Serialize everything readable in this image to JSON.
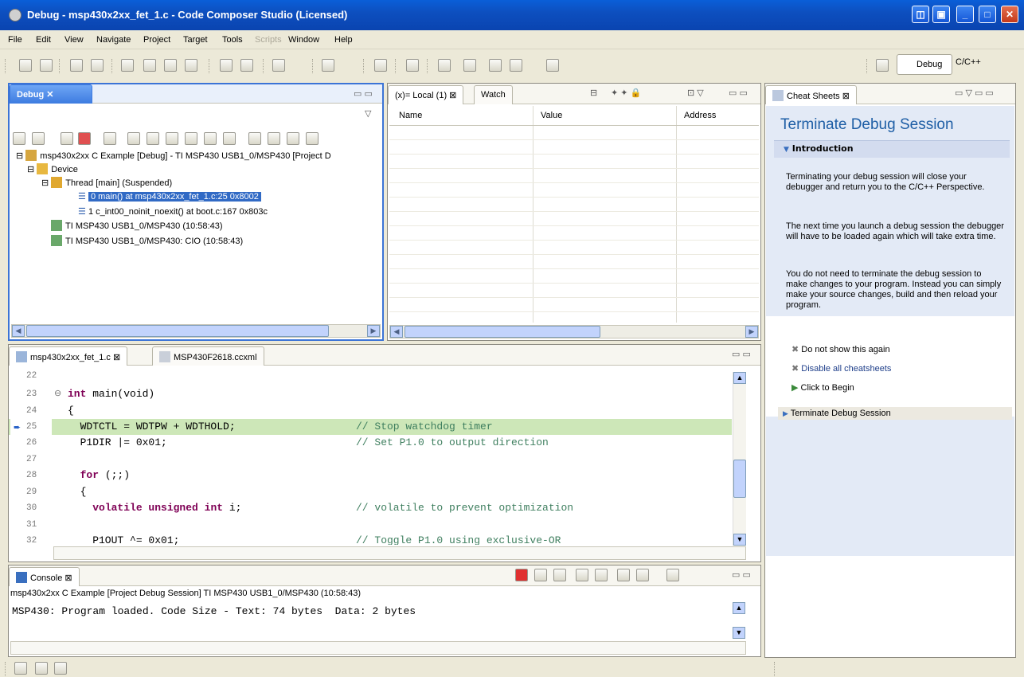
{
  "window": {
    "title": "Debug - msp430x2xx_fet_1.c - Code Composer Studio (Licensed)"
  },
  "menu": [
    "File",
    "Edit",
    "View",
    "Navigate",
    "Project",
    "Target",
    "Tools",
    "Scripts",
    "Window",
    "Help"
  ],
  "perspectives": {
    "debug": "Debug",
    "cpp": "C/C++"
  },
  "debug_view": {
    "tab": "Debug",
    "tree": [
      "msp430x2xx C Example [Debug] - TI MSP430 USB1_0/MSP430 [Project D",
      "Device",
      "Thread [main] (Suspended)",
      "0 main() at msp430x2xx_fet_1.c:25 0x8002",
      "1 c_int00_noinit_noexit() at boot.c:167 0x803c",
      "TI MSP430 USB1_0/MSP430 (10:58:43)",
      "TI MSP430 USB1_0/MSP430: CIO (10:58:43)"
    ]
  },
  "variables": {
    "tabs": [
      "(x)= Local (1)",
      "Watch"
    ],
    "columns": [
      "Name",
      "Value",
      "Address"
    ]
  },
  "editor": {
    "tabs": [
      "msp430x2xx_fet_1.c",
      "MSP430F2618.ccxml"
    ],
    "lines": [
      {
        "n": "22",
        "pre": "",
        "kw": "",
        "post": "",
        "cm": ""
      },
      {
        "n": "23",
        "pre": "",
        "kw": "int",
        "post": " main(void)",
        "cm": ""
      },
      {
        "n": "24",
        "pre": "{",
        "kw": "",
        "post": "",
        "cm": ""
      },
      {
        "n": "25",
        "pre": "  WDTCTL = WDTPW + WDTHOLD;",
        "kw": "",
        "post": "",
        "cm": "// Stop watchdog timer"
      },
      {
        "n": "26",
        "pre": "  P1DIR |= 0x01;",
        "kw": "",
        "post": "",
        "cm": "// Set P1.0 to output direction"
      },
      {
        "n": "27",
        "pre": "",
        "kw": "",
        "post": "",
        "cm": ""
      },
      {
        "n": "28",
        "pre": "  ",
        "kw": "for",
        "post": " (;;)",
        "cm": ""
      },
      {
        "n": "29",
        "pre": "  {",
        "kw": "",
        "post": "",
        "cm": ""
      },
      {
        "n": "30",
        "pre": "    ",
        "kw": "volatile unsigned int",
        "post": " i;",
        "cm": "// volatile to prevent optimization"
      },
      {
        "n": "31",
        "pre": "",
        "kw": "",
        "post": "",
        "cm": ""
      },
      {
        "n": "32",
        "pre": "    P1OUT ^= 0x01;",
        "kw": "",
        "post": "",
        "cm": "// Toggle P1.0 using exclusive-OR"
      }
    ]
  },
  "console": {
    "tab": "Console",
    "session": "msp430x2xx C Example [Project Debug Session] TI MSP430 USB1_0/MSP430 (10:58:43)",
    "output": "MSP430: Program loaded. Code Size - Text: 74 bytes  Data: 2 bytes"
  },
  "cheatsheet": {
    "tab": "Cheat Sheets",
    "title": "Terminate Debug Session",
    "section": "Introduction",
    "paragraphs": [
      "Terminating your debug session will close your debugger and return you to the C/C++ Perspective.",
      "The next time you launch a debug session the debugger will have to be loaded again which will take extra time.",
      "You do not need to terminate the debug session to make changes to your program. Instead you can simply make your source changes, build and then reload your program."
    ],
    "actions": [
      "Do not show this again",
      "Disable all cheatsheets",
      "Click to Begin"
    ],
    "subsection": "Terminate Debug Session"
  }
}
